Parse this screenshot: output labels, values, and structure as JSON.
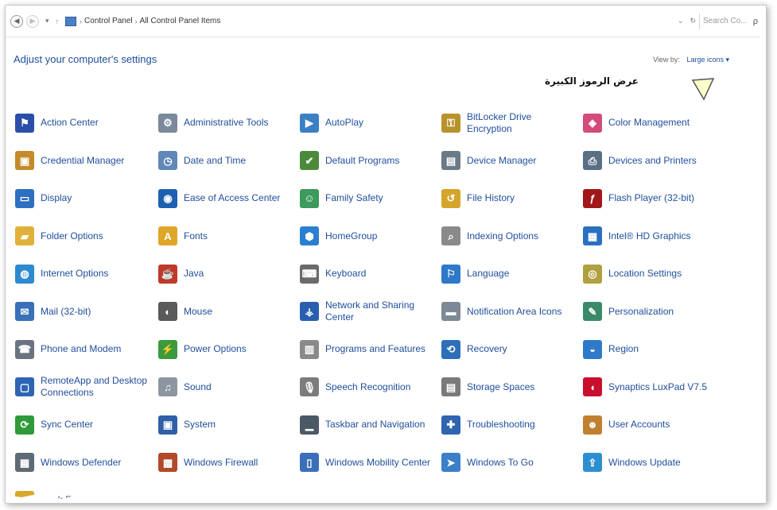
{
  "addressbar": {
    "crumbs": [
      "Control Panel",
      "All Control Panel Items"
    ],
    "search_placeholder": "Search Co...",
    "search_glyph": "ρ",
    "refresh_glyph": "↻"
  },
  "header": {
    "title": "Adjust your computer's settings",
    "viewby_label": "View by:",
    "viewby_value": "Large icons ▾",
    "annotation": "عرض الرموز الكبيرة"
  },
  "items": [
    {
      "label": "Action Center",
      "icon": "flag-icon",
      "color": "#2b4fa8",
      "glyph": "⚑"
    },
    {
      "label": "Administrative Tools",
      "icon": "admin-tools-icon",
      "color": "#7a8a9a",
      "glyph": "⚙"
    },
    {
      "label": "AutoPlay",
      "icon": "autoplay-icon",
      "color": "#3b7fc4",
      "glyph": "▶"
    },
    {
      "label": "BitLocker Drive Encryption",
      "icon": "bitlocker-icon",
      "color": "#b8922b",
      "glyph": "⚿"
    },
    {
      "label": "Color Management",
      "icon": "color-management-icon",
      "color": "#d24b7a",
      "glyph": "◈"
    },
    {
      "label": "Credential Manager",
      "icon": "credential-icon",
      "color": "#c58a2b",
      "glyph": "▣"
    },
    {
      "label": "Date and Time",
      "icon": "clock-icon",
      "color": "#5f88b8",
      "glyph": "◷"
    },
    {
      "label": "Default Programs",
      "icon": "default-programs-icon",
      "color": "#4a8a3a",
      "glyph": "✔"
    },
    {
      "label": "Device Manager",
      "icon": "device-manager-icon",
      "color": "#6b7a88",
      "glyph": "▤"
    },
    {
      "label": "Devices and Printers",
      "icon": "printer-icon",
      "color": "#5a6f84",
      "glyph": "⎙"
    },
    {
      "label": "Display",
      "icon": "display-icon",
      "color": "#2d6fc0",
      "glyph": "▭"
    },
    {
      "label": "Ease of Access Center",
      "icon": "ease-of-access-icon",
      "color": "#1f5fb0",
      "glyph": "◉"
    },
    {
      "label": "Family Safety",
      "icon": "family-safety-icon",
      "color": "#3c9a5c",
      "glyph": "☺"
    },
    {
      "label": "File History",
      "icon": "file-history-icon",
      "color": "#d4a52a",
      "glyph": "↺"
    },
    {
      "label": "Flash Player (32-bit)",
      "icon": "flash-icon",
      "color": "#a01818",
      "glyph": "ƒ"
    },
    {
      "label": "Folder Options",
      "icon": "folder-options-icon",
      "color": "#e0b13a",
      "glyph": "▰"
    },
    {
      "label": "Fonts",
      "icon": "fonts-icon",
      "color": "#e0a628",
      "glyph": "A"
    },
    {
      "label": "HomeGroup",
      "icon": "homegroup-icon",
      "color": "#2b7fd0",
      "glyph": "⬢"
    },
    {
      "label": "Indexing Options",
      "icon": "indexing-icon",
      "color": "#8a8a8a",
      "glyph": "⌕"
    },
    {
      "label": "Intel® HD Graphics",
      "icon": "intel-graphics-icon",
      "color": "#2b6fc0",
      "glyph": "▦"
    },
    {
      "label": "Internet Options",
      "icon": "internet-options-icon",
      "color": "#2d8ad0",
      "glyph": "◍"
    },
    {
      "label": "Java",
      "icon": "java-icon",
      "color": "#c0392b",
      "glyph": "☕"
    },
    {
      "label": "Keyboard",
      "icon": "keyboard-icon",
      "color": "#6b6b6b",
      "glyph": "⌨"
    },
    {
      "label": "Language",
      "icon": "language-icon",
      "color": "#2f79c8",
      "glyph": "⚐"
    },
    {
      "label": "Location Settings",
      "icon": "location-icon",
      "color": "#b0a040",
      "glyph": "◎"
    },
    {
      "label": "Mail (32-bit)",
      "icon": "mail-icon",
      "color": "#3a70b8",
      "glyph": "✉"
    },
    {
      "label": "Mouse",
      "icon": "mouse-icon",
      "color": "#5a5a5a",
      "glyph": "◐"
    },
    {
      "label": "Network and Sharing Center",
      "icon": "network-icon",
      "color": "#2a5fb0",
      "glyph": "⚶"
    },
    {
      "label": "Notification Area Icons",
      "icon": "notification-area-icon",
      "color": "#7d8a96",
      "glyph": "▬"
    },
    {
      "label": "Personalization",
      "icon": "personalization-icon",
      "color": "#3a8a6a",
      "glyph": "✎"
    },
    {
      "label": "Phone and Modem",
      "icon": "phone-icon",
      "color": "#6a7480",
      "glyph": "☎"
    },
    {
      "label": "Power Options",
      "icon": "power-icon",
      "color": "#3c9a3c",
      "glyph": "⚡"
    },
    {
      "label": "Programs and Features",
      "icon": "programs-icon",
      "color": "#8a8a8a",
      "glyph": "▥"
    },
    {
      "label": "Recovery",
      "icon": "recovery-icon",
      "color": "#2f6fb8",
      "glyph": "⟲"
    },
    {
      "label": "Region",
      "icon": "region-icon",
      "color": "#2f7ac8",
      "glyph": "◒"
    },
    {
      "label": "RemoteApp and Desktop Connections",
      "icon": "remoteapp-icon",
      "color": "#2d64b4",
      "glyph": "▢"
    },
    {
      "label": "Sound",
      "icon": "sound-icon",
      "color": "#8d96a0",
      "glyph": "♫"
    },
    {
      "label": "Speech Recognition",
      "icon": "microphone-icon",
      "color": "#7c7c7c",
      "glyph": "🎙"
    },
    {
      "label": "Storage Spaces",
      "icon": "storage-spaces-icon",
      "color": "#7a7a7a",
      "glyph": "▤"
    },
    {
      "label": "Synaptics LuxPad V7.5",
      "icon": "synaptics-icon",
      "color": "#c8102e",
      "glyph": "◖"
    },
    {
      "label": "Sync Center",
      "icon": "sync-icon",
      "color": "#2f9a3a",
      "glyph": "⟳"
    },
    {
      "label": "System",
      "icon": "system-icon",
      "color": "#2f5fa8",
      "glyph": "▣"
    },
    {
      "label": "Taskbar and Navigation",
      "icon": "taskbar-icon",
      "color": "#4a5868",
      "glyph": "▁"
    },
    {
      "label": "Troubleshooting",
      "icon": "troubleshooting-icon",
      "color": "#2f64b0",
      "glyph": "✚"
    },
    {
      "label": "User Accounts",
      "icon": "user-accounts-icon",
      "color": "#c08030",
      "glyph": "☻"
    },
    {
      "label": "Windows Defender",
      "icon": "defender-icon",
      "color": "#5e6a74",
      "glyph": "▦"
    },
    {
      "label": "Windows Firewall",
      "icon": "firewall-icon",
      "color": "#b04a2a",
      "glyph": "▩"
    },
    {
      "label": "Windows Mobility Center",
      "icon": "mobility-icon",
      "color": "#3b6fb8",
      "glyph": "▯"
    },
    {
      "label": "Windows To Go",
      "icon": "windows-to-go-icon",
      "color": "#3a7fc8",
      "glyph": "➤"
    },
    {
      "label": "Windows Update",
      "icon": "windows-update-icon",
      "color": "#2e8fd0",
      "glyph": "⇪"
    },
    {
      "label": "Work Folders",
      "icon": "work-folders-icon",
      "color": "#d8a82a",
      "glyph": "▰"
    }
  ]
}
